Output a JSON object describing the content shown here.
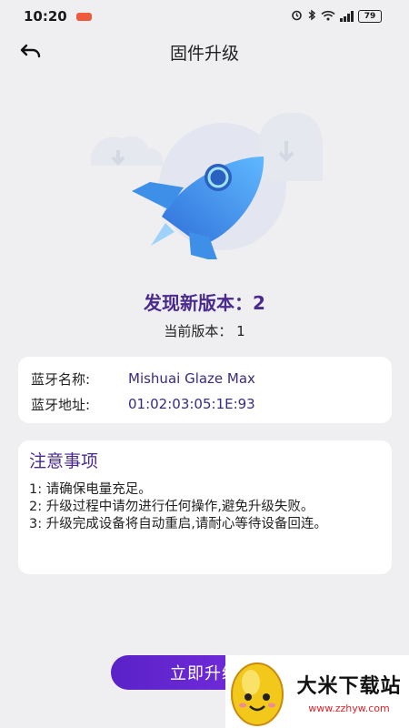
{
  "status_bar": {
    "time": "10:20",
    "battery": "79",
    "icons": [
      "alarm-icon",
      "bluetooth-icon",
      "wifi-icon",
      "signal-icon",
      "battery-icon"
    ]
  },
  "header": {
    "back_icon": "back-arrow-icon",
    "title": "固件升级"
  },
  "hero": {
    "illustration": "rocket-icon"
  },
  "version": {
    "new_version": "发现新版本：2",
    "current_version": "当前版本：  1"
  },
  "bluetooth": {
    "name_label": "蓝牙名称:",
    "name_value": "Mishuai Glaze Max",
    "address_label": "蓝牙地址:",
    "address_value": "01:02:03:05:1E:93"
  },
  "notes": {
    "title": "注意事项",
    "items": [
      "1:  请确保电量充足。",
      "2:  升级过程中请勿进行任何操作,避免升级失败。",
      "3:  升级完成设备将自动重启,请耐心等待设备回连。"
    ]
  },
  "actions": {
    "upgrade_label": "立即升级"
  },
  "watermark": {
    "name": "大米下载站",
    "url": "www.zzhyw.com"
  },
  "colors": {
    "accent": "#4a2a8e",
    "button": "#6a28d8",
    "background": "#efeff1",
    "rocket": "#3d8fe8"
  }
}
